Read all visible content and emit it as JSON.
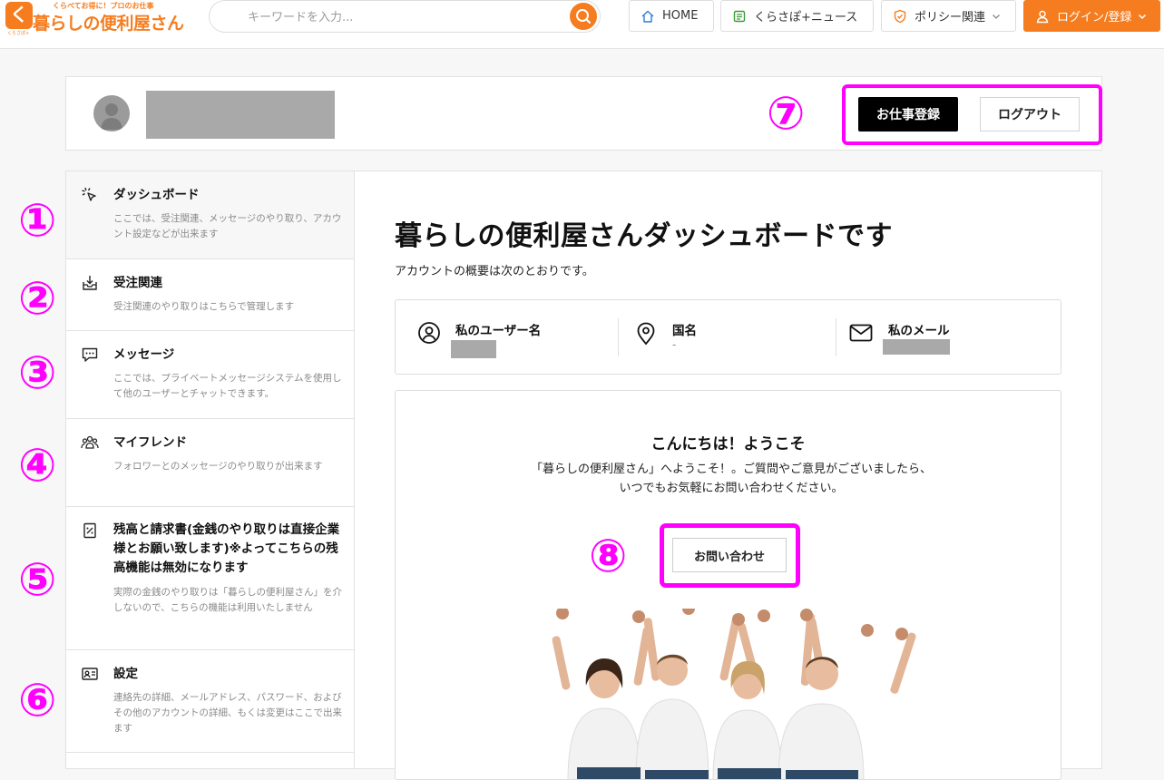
{
  "header": {
    "logo_tagline": "くらべてお得に！プロのお仕事",
    "logo_name": "暮らしの便利屋さん",
    "logo_small": "くらさぽ+",
    "search_placeholder": "キーワードを入力...",
    "nav": {
      "home": "HOME",
      "news": "くらさぽ+ニュース",
      "policy": "ポリシー関連",
      "login": "ログイン/登録"
    },
    "accent_color": "#f57d1f"
  },
  "profile": {
    "job_button": "お仕事登録",
    "logout_button": "ログアウト",
    "annotation": "⑦"
  },
  "sidebar": {
    "items": [
      {
        "num": "①",
        "title": "ダッシュボード",
        "desc": "ここでは、受注関連、メッセージのやり取り、アカウント設定などが出来ます",
        "icon": "cursor-click-icon"
      },
      {
        "num": "②",
        "title": "受注関連",
        "desc": "受注関連のやり取りはこちらで管理します",
        "icon": "inbox-download-icon"
      },
      {
        "num": "③",
        "title": "メッセージ",
        "desc": "ここでは、プライベートメッセージシステムを使用して他のユーザーとチャットできます。",
        "icon": "chat-bubble-icon"
      },
      {
        "num": "④",
        "title": "マイフレンド",
        "desc": "フォロワーとのメッセージのやり取りが出来ます",
        "icon": "group-icon"
      },
      {
        "num": "⑤",
        "title": "残高と請求書(金銭のやり取りは直接企業様とお願い致します)※よってこちらの残高機能は無効になります",
        "desc": "実際の金銭のやり取りは「暮らしの便利屋さん」を介しないので、こちらの機能は利用いたしません",
        "icon": "invoice-icon"
      },
      {
        "num": "⑥",
        "title": "設定",
        "desc": "連絡先の詳細、メールアドレス、パスワード、およびその他のアカウントの詳細、もくは変更はここで出来ます",
        "icon": "id-card-icon"
      }
    ]
  },
  "main": {
    "title": "暮らしの便利屋さんダッシュボードです",
    "subtitle": "アカウントの概要は次のとおりです。",
    "stats": {
      "username_label": "私のユーザー名",
      "country_label": "国名",
      "country_value": "-",
      "email_label": "私のメール"
    },
    "welcome": {
      "title": "こんにちは！ようこそ",
      "text": "「暮らしの便利屋さん」へようこそ！。ご質問やご意見がございましたら、いつでもお気軽にお問い合わせください。",
      "contact_button": "お問い合わせ",
      "annotation": "⑧"
    }
  },
  "annotation_color": "#ff00ff"
}
